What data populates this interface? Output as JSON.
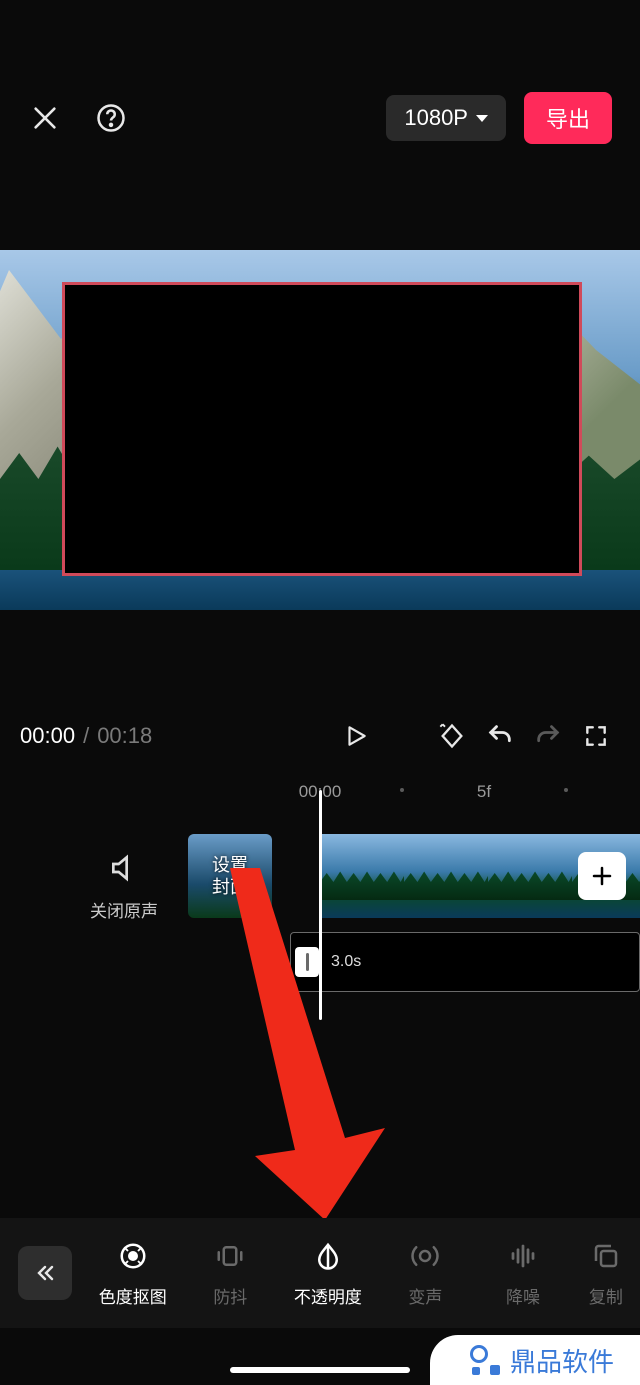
{
  "header": {
    "resolution": "1080P",
    "export_label": "导出"
  },
  "transport": {
    "current_time": "00:00",
    "separator": "/",
    "duration": "00:18"
  },
  "ruler": {
    "mark1": "00:00",
    "mark2": "5f"
  },
  "timeline": {
    "mute_label": "关闭原声",
    "cover_label": "设置\n封面",
    "audio_duration": "3.0s"
  },
  "toolbar": {
    "items": [
      {
        "label": "色度抠图",
        "active": true
      },
      {
        "label": "防抖",
        "active": false
      },
      {
        "label": "不透明度",
        "active": true
      },
      {
        "label": "变声",
        "active": false
      },
      {
        "label": "降噪",
        "active": false
      },
      {
        "label": "复制",
        "active": false
      }
    ]
  },
  "watermark": {
    "text": "鼎品软件"
  }
}
